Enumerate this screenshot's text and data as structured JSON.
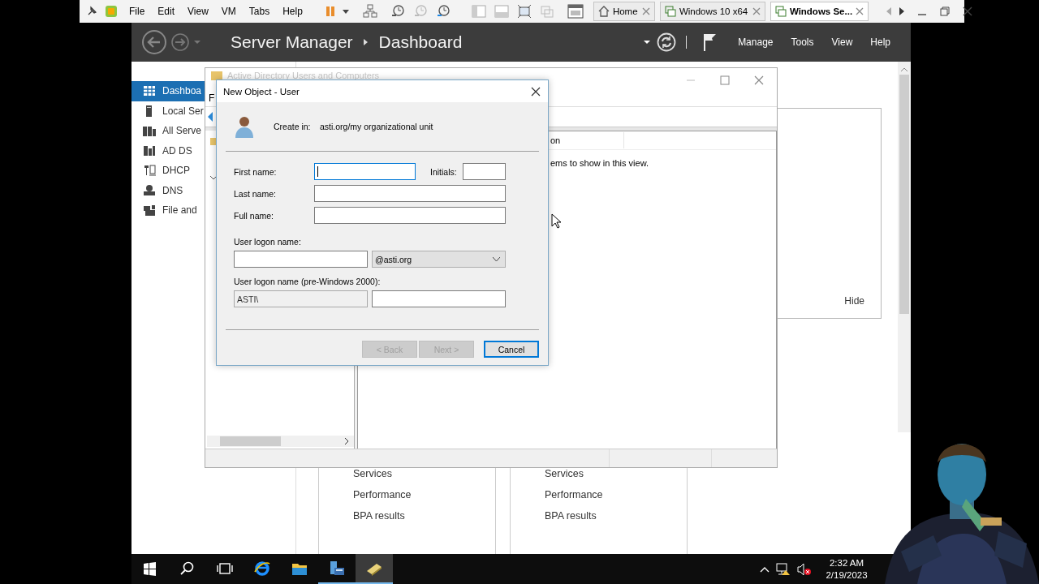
{
  "vm_toolbar": {
    "menus": [
      "File",
      "Edit",
      "View",
      "VM",
      "Tabs",
      "Help"
    ],
    "tabs": [
      {
        "label": "Home",
        "kind": "home",
        "selected": false
      },
      {
        "label": "Windows 10 x64",
        "kind": "vm",
        "selected": false
      },
      {
        "label": "Windows Se...",
        "kind": "vm",
        "selected": true
      }
    ]
  },
  "server_manager": {
    "breadcrumb": [
      "Server Manager",
      "Dashboard"
    ],
    "menus": [
      "Manage",
      "Tools",
      "View",
      "Help"
    ],
    "sidebar": [
      {
        "label": "Dashboa",
        "kind": "dashboard",
        "selected": true
      },
      {
        "label": "Local Ser",
        "kind": "server",
        "selected": false
      },
      {
        "label": "All Serve",
        "kind": "servers",
        "selected": false
      },
      {
        "label": "AD DS",
        "kind": "adds",
        "selected": false
      },
      {
        "label": "DHCP",
        "kind": "dhcp",
        "selected": false
      },
      {
        "label": "DNS",
        "kind": "dns",
        "selected": false
      },
      {
        "label": "File and",
        "kind": "files",
        "selected": false
      }
    ],
    "welcome": {
      "hide_link": "Hide"
    },
    "tiles": [
      {
        "items": [
          "Services",
          "Performance",
          "BPA results"
        ]
      },
      {
        "items": [
          "Services",
          "Performance",
          "BPA results"
        ]
      }
    ]
  },
  "aduc_window": {
    "title": "Active Directory Users and Computers",
    "menu": "F",
    "column_header": "on",
    "empty_message": "ems to show in this view."
  },
  "dialog": {
    "title": "New Object - User",
    "create_in": {
      "label": "Create in:",
      "value": "asti.org/my organizational unit"
    },
    "name_fields": [
      {
        "label": "First name:",
        "focused": true
      },
      {
        "label": "Initials:",
        "focused": false
      },
      {
        "label": "Last name:",
        "focused": false
      },
      {
        "label": "Full name:",
        "focused": false
      }
    ],
    "logon": {
      "label": "User logon name:",
      "domain": "@asti.org"
    },
    "pre2000": {
      "label": "User logon name (pre-Windows 2000):",
      "prefix": "ASTI\\"
    },
    "buttons": [
      {
        "label": "< Back",
        "disabled": true,
        "default": false
      },
      {
        "label": "Next >",
        "disabled": true,
        "default": false
      },
      {
        "label": "Cancel",
        "disabled": false,
        "default": true
      }
    ]
  },
  "taskbar": {
    "apps": [
      {
        "kind": "start",
        "active": false,
        "running": false
      },
      {
        "kind": "search",
        "active": false,
        "running": false
      },
      {
        "kind": "task_view",
        "active": false,
        "running": false
      },
      {
        "kind": "browser",
        "active": false,
        "running": false
      },
      {
        "kind": "files",
        "active": false,
        "running": false
      },
      {
        "kind": "server_manager",
        "active": false,
        "running": true
      },
      {
        "kind": "tool",
        "active": true,
        "running": true
      }
    ],
    "clock": {
      "time": "2:32 AM",
      "date": "2/19/2023"
    }
  }
}
